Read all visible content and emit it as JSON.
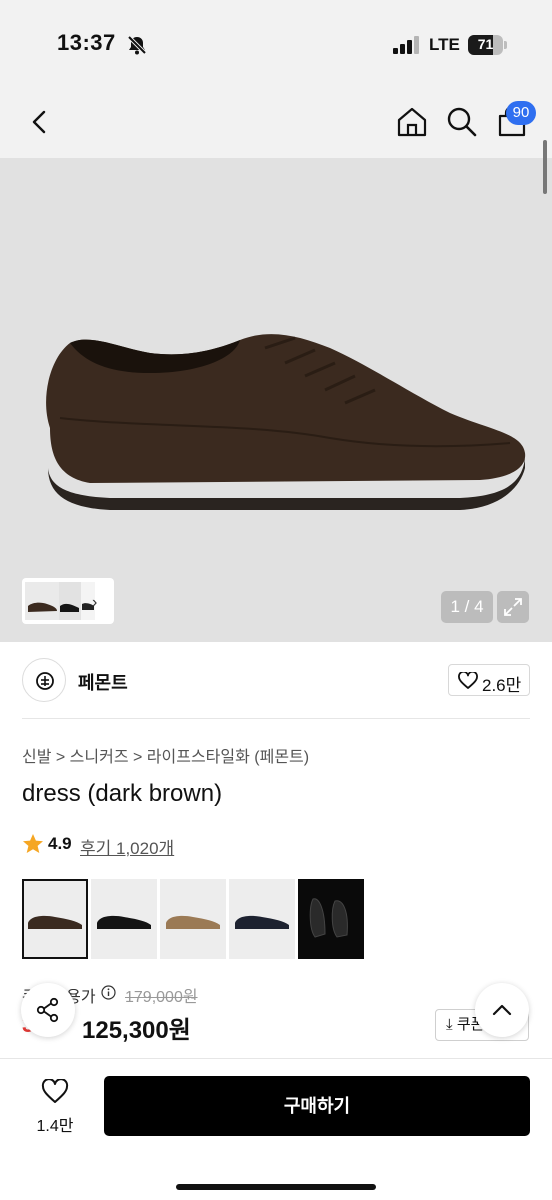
{
  "status_bar": {
    "time": "13:37",
    "network": "LTE",
    "battery_level": "71",
    "icons": [
      "bell-off-icon",
      "signal-icon",
      "battery-icon"
    ]
  },
  "header": {
    "icons": [
      "back-icon",
      "home-icon",
      "search-icon",
      "cart-icon"
    ],
    "cart_badge": "90"
  },
  "gallery": {
    "counter": "1 / 4",
    "current_index": 1,
    "total": 4
  },
  "brand": {
    "name": "페몬트",
    "like_count": "2.6만"
  },
  "breadcrumb": "신발 > 스니커즈 > 라이프스타일화 (페몬트)",
  "product": {
    "title": "dress (dark brown)",
    "rating": "4.9",
    "reviews": "후기 1,020개"
  },
  "variants": [
    {
      "name": "dark brown",
      "color": "#3a2a20",
      "selected": true
    },
    {
      "name": "black",
      "color": "#141414",
      "selected": false
    },
    {
      "name": "tan",
      "color": "#9b7a55",
      "selected": false
    },
    {
      "name": "navy black",
      "color": "#1d2230",
      "selected": false
    },
    {
      "name": "black leather",
      "color": "#0a0a0a",
      "selected": false
    }
  ],
  "price": {
    "label": "쿠폰적용가",
    "original": "179,000원",
    "discount": "30%",
    "sale": "125,300원",
    "coupon_button": "쿠폰"
  },
  "bottom_bar": {
    "wish_count": "1.4만",
    "buy_label": "구매하기"
  },
  "colors": {
    "accent": "#2f6ff0",
    "discount": "#e53935",
    "buy_button": "#000000",
    "star": "#f5a623"
  }
}
